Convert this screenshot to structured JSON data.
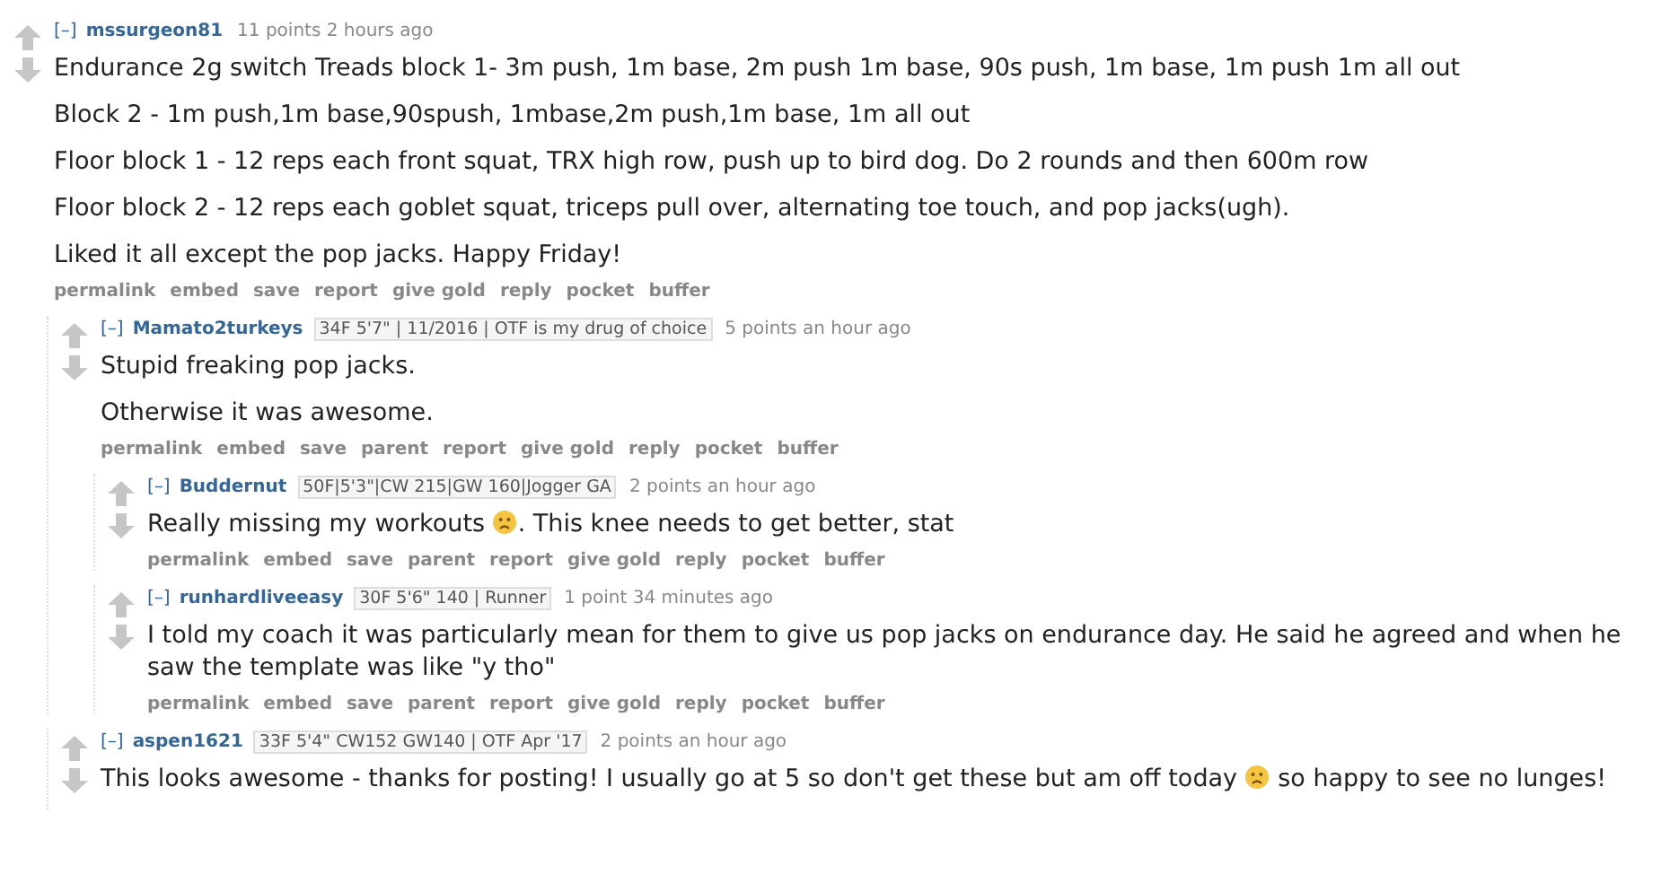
{
  "comments": [
    {
      "collapse": "[–]",
      "author": "mssurgeon81",
      "score": "11 points 2 hours ago",
      "paragraphs": [
        {
          "parts": [
            "Endurance 2g switch Treads block 1- 3m push, 1m base, 2m push 1m base, 90s push, 1m base, 1m push 1m all out"
          ]
        },
        {
          "parts": [
            "Block 2 - 1m push,1m base,90spush, 1mbase,2m push,1m base, 1m all out"
          ]
        },
        {
          "parts": [
            "Floor block 1 - 12 reps each front squat, TRX high row, push up to bird dog. Do 2 rounds and then 600m row"
          ]
        },
        {
          "parts": [
            "Floor block 2 - 12 reps each goblet squat, triceps pull over, alternating toe touch, and pop jacks(ugh)."
          ]
        },
        {
          "parts": [
            "Liked it all except the pop jacks. Happy Friday!"
          ]
        }
      ],
      "actions": [
        "permalink",
        "embed",
        "save",
        "report",
        "give gold",
        "reply",
        "pocket",
        "buffer"
      ],
      "children": [
        {
          "collapse": "[–]",
          "author": "Mamato2turkeys",
          "flair": "34F 5'7\" | 11/2016 | OTF is my drug of choice",
          "score": "5 points an hour ago",
          "paragraphs": [
            {
              "parts": [
                "Stupid freaking pop jacks."
              ]
            },
            {
              "parts": [
                "Otherwise it was awesome."
              ]
            }
          ],
          "actions": [
            "permalink",
            "embed",
            "save",
            "parent",
            "report",
            "give gold",
            "reply",
            "pocket",
            "buffer"
          ],
          "children": [
            {
              "collapse": "[–]",
              "author": "Buddernut",
              "flair": "50F|5'3\"|CW 215|GW 160|Jogger GA",
              "score": "2 points an hour ago",
              "paragraphs": [
                {
                  "parts": [
                    "Really missing my workouts",
                    ". This knee needs to get better, stat"
                  ]
                }
              ],
              "actions": [
                "permalink",
                "embed",
                "save",
                "parent",
                "report",
                "give gold",
                "reply",
                "pocket",
                "buffer"
              ]
            },
            {
              "collapse": "[–]",
              "author": "runhardliveeasy",
              "flair": "30F 5'6\" 140 | Runner",
              "score": "1 point 34 minutes ago",
              "paragraphs": [
                {
                  "parts": [
                    "I told my coach it was particularly mean for them to give us pop jacks on endurance day. He said he agreed and when he saw the template was like \"y tho\""
                  ]
                }
              ],
              "actions": [
                "permalink",
                "embed",
                "save",
                "parent",
                "report",
                "give gold",
                "reply",
                "pocket",
                "buffer"
              ]
            }
          ]
        },
        {
          "collapse": "[–]",
          "author": "aspen1621",
          "flair": "33F 5'4\" CW152 GW140 | OTF Apr '17",
          "score": "2 points an hour ago",
          "paragraphs": [
            {
              "parts": [
                "This looks awesome - thanks for posting! I usually go at 5 so don't get these but am off today",
                "so happy to see no lunges!"
              ]
            }
          ]
        }
      ]
    }
  ]
}
